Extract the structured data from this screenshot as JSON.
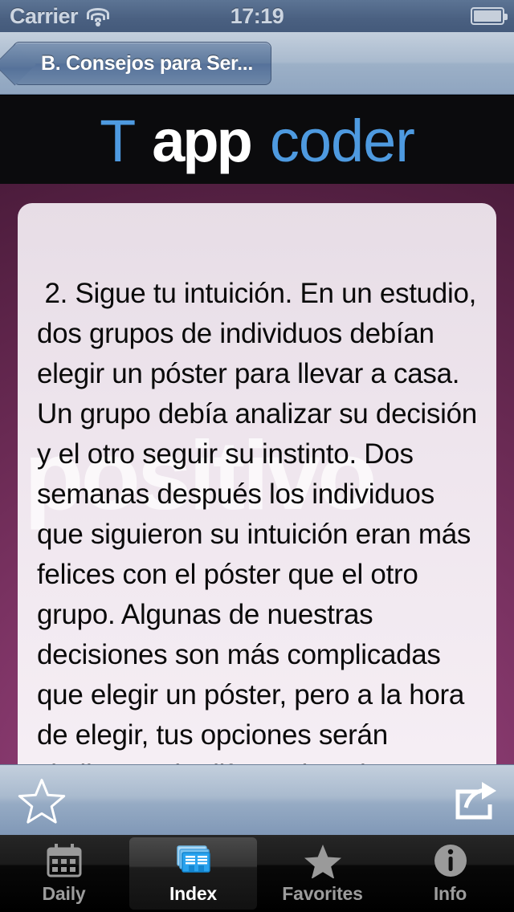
{
  "status_bar": {
    "carrier": "Carrier",
    "wifi_icon": "wifi-icon",
    "time": "17:19",
    "battery_icon": "battery-full-icon"
  },
  "nav_bar": {
    "back_button_label": "B. Consejos para Ser...",
    "back_chevron_icon": "chevron-left-icon"
  },
  "logo_banner": {
    "part_t": "T",
    "part_app": "app",
    "part_coder": "coder",
    "accent_color": "#4e9ae0",
    "app_color": "#ffffff",
    "background_color": "#0b0b0d"
  },
  "article": {
    "watermark_text": "positivo",
    "body": " 2. Sigue tu intuición. En un estudio, dos grupos de individuos debían elegir un póster para llevar a casa. Un grupo debía analizar su decisión y el otro seguir su instinto. Dos semanas después los individuos que siguieron su intuición eran más felices con el póster que el otro grupo. Algunas de nuestras decisiones son más complicadas que elegir un póster, pero a la hora de elegir, tus opciones serán similares y la diferencia solo afectará temporalmente a tu felicidad. La próxima vez que tengas que tomar"
  },
  "toolbar": {
    "favorite_icon": "star-outline-icon",
    "share_icon": "share-export-icon"
  },
  "tab_bar": {
    "selected_index": 1,
    "tabs": [
      {
        "label": "Daily",
        "icon": "calendar-icon"
      },
      {
        "label": "Index",
        "icon": "stacked-pages-icon"
      },
      {
        "label": "Favorites",
        "icon": "star-filled-icon"
      },
      {
        "label": "Info",
        "icon": "info-circle-icon"
      }
    ]
  }
}
